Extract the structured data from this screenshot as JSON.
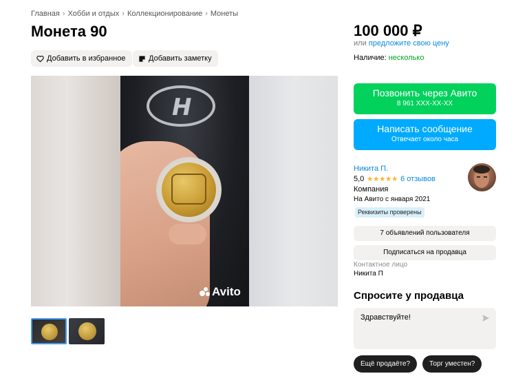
{
  "breadcrumb": [
    "Главная",
    "Хобби и отдых",
    "Коллекционирование",
    "Монеты"
  ],
  "title": "Монета 90",
  "actions": {
    "favorite": "Добавить в избранное",
    "note": "Добавить заметку"
  },
  "price": "100 000 ₽",
  "offer": {
    "prefix": "или",
    "link": "предложите свою цену"
  },
  "availability": {
    "label": "Наличие: ",
    "value": "несколько"
  },
  "call_button": {
    "label": "Позвонить через Авито",
    "phone": "8 961 XXX-XX-XX"
  },
  "message_button": {
    "label": "Написать сообщение",
    "sub": "Отвечает около часа"
  },
  "seller": {
    "name": "Никита П.",
    "rating": "5,0",
    "stars": "★★★★★",
    "reviews": "6 отзывов",
    "type": "Компания",
    "since": "На Авито с января 2021",
    "verified": "Реквизиты проверены"
  },
  "seller_buttons": {
    "ads": "7 объявлений пользователя",
    "subscribe": "Подписаться на продавца"
  },
  "contact": {
    "label": "Контактное лицо",
    "name": "Никита П"
  },
  "ask": {
    "title": "Спросите у продавца",
    "message": "Здравствуйте!",
    "chips": [
      "Ещё продаёте?",
      "Торг уместен?"
    ]
  },
  "gallery": {
    "watermark": "Avito",
    "photo_count": 2,
    "active_index": 0
  },
  "colors": {
    "call": "#02d15c",
    "message": "#00aaff",
    "link": "#0a8ad8",
    "available": "#02a820",
    "stars": "#ffb021"
  }
}
